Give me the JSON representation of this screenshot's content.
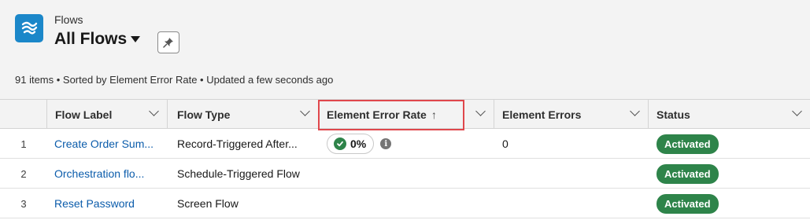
{
  "header": {
    "object_label": "Flows",
    "view_title": "All Flows",
    "summary": "91 items • Sorted by Element Error Rate • Updated a few seconds ago"
  },
  "columns": [
    {
      "label": "Flow Label"
    },
    {
      "label": "Flow Type"
    },
    {
      "label": "Element Error Rate",
      "sort": "↑"
    },
    {
      "label": "Element Errors"
    },
    {
      "label": "Status"
    }
  ],
  "rows": [
    {
      "num": "1",
      "label": "Create Order Sum...",
      "type": "Record-Triggered After...",
      "rate": "0%",
      "errors": "0",
      "status": "Activated"
    },
    {
      "num": "2",
      "label": "Orchestration flo...",
      "type": "Schedule-Triggered Flow",
      "rate": "",
      "errors": "",
      "status": "Activated"
    },
    {
      "num": "3",
      "label": "Reset Password",
      "type": "Screen Flow",
      "rate": "",
      "errors": "",
      "status": "Activated"
    }
  ],
  "colors": {
    "brand": "#1b87c9",
    "success": "#2e844a",
    "link": "#0b5cab",
    "highlight": "#e0474c"
  }
}
